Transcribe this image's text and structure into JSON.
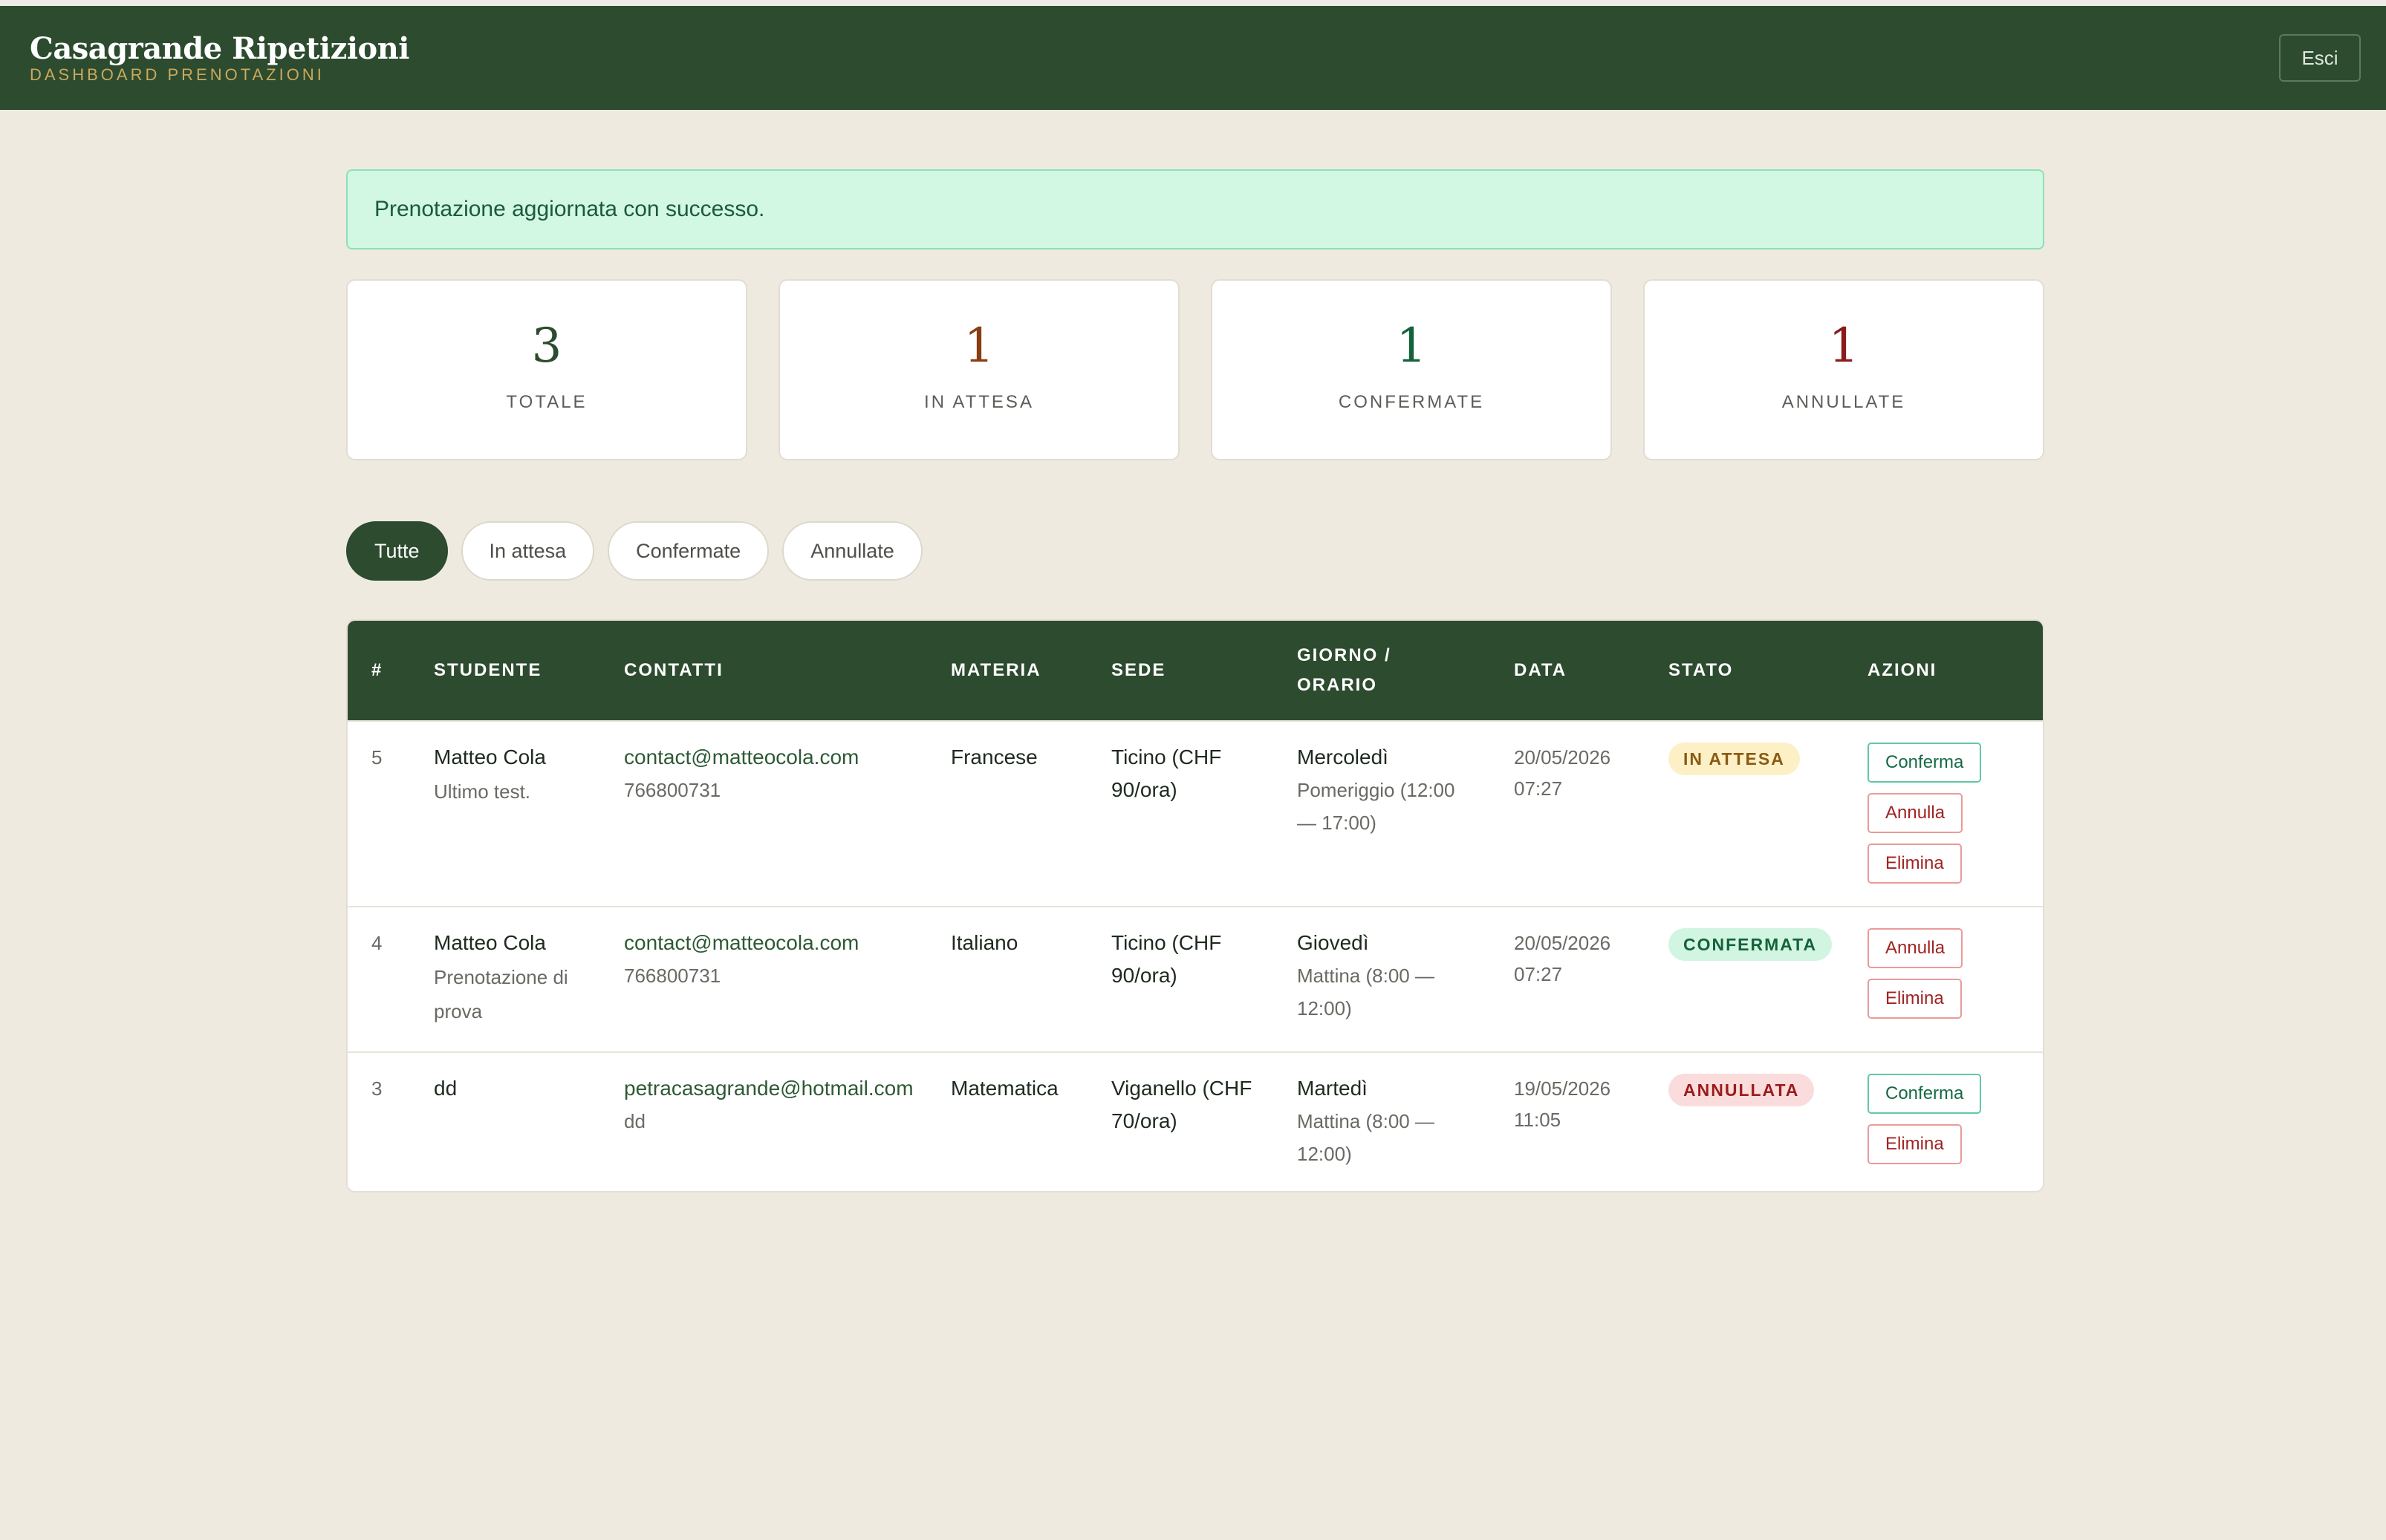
{
  "header": {
    "title": "Casagrande Ripetizioni",
    "subtitle": "DASHBOARD PRENOTAZIONI",
    "logout_label": "Esci"
  },
  "alert": {
    "message": "Prenotazione aggiornata con successo."
  },
  "stats": [
    {
      "value": "3",
      "label": "TOTALE",
      "color": "#2d4b2f"
    },
    {
      "value": "1",
      "label": "IN ATTESA",
      "color": "#8a3d10"
    },
    {
      "value": "1",
      "label": "CONFERMATE",
      "color": "#14623a"
    },
    {
      "value": "1",
      "label": "ANNULLATE",
      "color": "#8b1a1a"
    }
  ],
  "filters": [
    {
      "label": "Tutte",
      "active": true
    },
    {
      "label": "In attesa",
      "active": false
    },
    {
      "label": "Confermate",
      "active": false
    },
    {
      "label": "Annullate",
      "active": false
    }
  ],
  "table": {
    "headers": {
      "id": "#",
      "student": "STUDENTE",
      "contacts": "CONTATTI",
      "subject": "MATERIA",
      "location": "SEDE",
      "day_time_1": "GIORNO /",
      "day_time_2": "ORARIO",
      "date": "DATA",
      "status": "STATO",
      "actions": "AZIONI"
    },
    "rows": [
      {
        "id": "5",
        "name": "Matteo Cola",
        "note_1": "Ultimo test.",
        "note_2": "",
        "email": "contact@matteocola.com",
        "phone": "766800731",
        "subject": "Francese",
        "location_1": "Ticino (CHF",
        "location_2": "90/ora)",
        "day": "Mercoledì",
        "slot_1": "Pomeriggio (12:00",
        "slot_2": "— 17:00)",
        "date_1": "20/05/2026",
        "date_2": "07:27",
        "status": "IN ATTESA",
        "actions": [
          "Conferma",
          "Annulla",
          "Elimina"
        ]
      },
      {
        "id": "4",
        "name": "Matteo Cola",
        "note_1": "Prenotazione di",
        "note_2": "prova",
        "email": "contact@matteocola.com",
        "phone": "766800731",
        "subject": "Italiano",
        "location_1": "Ticino (CHF",
        "location_2": "90/ora)",
        "day": "Giovedì",
        "slot_1": "Mattina (8:00 —",
        "slot_2": "12:00)",
        "date_1": "20/05/2026",
        "date_2": "07:27",
        "status": "CONFERMATA",
        "actions": [
          "Annulla",
          "Elimina"
        ]
      },
      {
        "id": "3",
        "name": "dd",
        "note_1": "",
        "note_2": "",
        "email": "petracasagrande@hotmail.com",
        "phone": "dd",
        "subject": "Matematica",
        "location_1": "Viganello (CHF",
        "location_2": "70/ora)",
        "day": "Martedì",
        "slot_1": "Mattina (8:00 —",
        "slot_2": "12:00)",
        "date_1": "19/05/2026",
        "date_2": "11:05",
        "status": "ANNULLATA",
        "actions": [
          "Conferma",
          "Elimina"
        ]
      }
    ]
  }
}
